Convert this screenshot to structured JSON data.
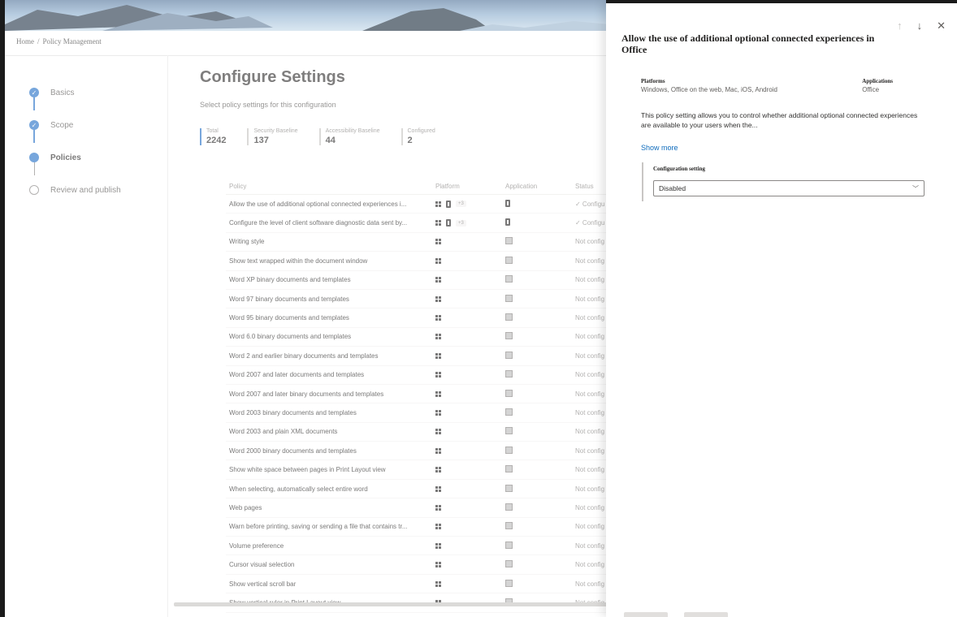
{
  "breadcrumb": {
    "home": "Home",
    "sep": "/",
    "current": "Policy Management"
  },
  "steps": [
    {
      "label": "Basics",
      "state": "done"
    },
    {
      "label": "Scope",
      "state": "done"
    },
    {
      "label": "Policies",
      "state": "active"
    },
    {
      "label": "Review and publish",
      "state": "pending"
    }
  ],
  "page": {
    "title": "Configure Settings",
    "subtitle": "Select policy settings for this configuration"
  },
  "stats": [
    {
      "label": "Total",
      "value": "2242"
    },
    {
      "label": "Security Baseline",
      "value": "137"
    },
    {
      "label": "Accessibility Baseline",
      "value": "44"
    },
    {
      "label": "Configured",
      "value": "2"
    }
  ],
  "table": {
    "headers": {
      "policy": "Policy",
      "platform": "Platform",
      "application": "Application",
      "status": "Status"
    },
    "rows": [
      {
        "policy": "Allow the use of additional optional connected experiences i...",
        "extra": "+3",
        "status": "✓ Configu"
      },
      {
        "policy": "Configure the level of client software diagnostic data sent by...",
        "extra": "+3",
        "status": "✓ Configu"
      },
      {
        "policy": "Writing style",
        "status": "Not config"
      },
      {
        "policy": "Show text wrapped within the document window",
        "status": "Not config"
      },
      {
        "policy": "Word XP binary documents and templates",
        "status": "Not config"
      },
      {
        "policy": "Word 97 binary documents and templates",
        "status": "Not config"
      },
      {
        "policy": "Word 95 binary documents and templates",
        "status": "Not config"
      },
      {
        "policy": "Word 6.0 binary documents and templates",
        "status": "Not config"
      },
      {
        "policy": "Word 2 and earlier binary documents and templates",
        "status": "Not config"
      },
      {
        "policy": "Word 2007 and later documents and templates",
        "status": "Not config"
      },
      {
        "policy": "Word 2007 and later binary documents and templates",
        "status": "Not config"
      },
      {
        "policy": "Word 2003 binary documents and templates",
        "status": "Not config"
      },
      {
        "policy": "Word 2003 and plain XML documents",
        "status": "Not config"
      },
      {
        "policy": "Word 2000 binary documents and templates",
        "status": "Not config"
      },
      {
        "policy": "Show white space between pages in Print Layout view",
        "status": "Not config"
      },
      {
        "policy": "When selecting, automatically select entire word",
        "status": "Not config"
      },
      {
        "policy": "Web pages",
        "status": "Not config"
      },
      {
        "policy": "Warn before printing, saving or sending a file that contains tr...",
        "status": "Not config"
      },
      {
        "policy": "Volume preference",
        "status": "Not config"
      },
      {
        "policy": "Cursor visual selection",
        "status": "Not config"
      },
      {
        "policy": "Show vertical scroll bar",
        "status": "Not config"
      },
      {
        "policy": "Show vertical ruler in Print Layout view",
        "status": "Not config"
      }
    ]
  },
  "panel": {
    "title": "Allow the use of additional optional connected experiences in Office",
    "nav": {
      "up": "↑",
      "down": "↓",
      "close": "✕"
    },
    "platforms_label": "Platforms",
    "platforms_value": "Windows, Office on the web, Mac, iOS, Android",
    "applications_label": "Applications",
    "applications_value": "Office",
    "description": "This policy setting allows you to control whether additional optional connected experiences are available to your users when the...",
    "show_more": "Show more",
    "config_label": "Configuration setting",
    "config_value": "Disabled"
  },
  "colors": {
    "accent": "#2f77c9",
    "link": "#0f6cbd"
  },
  "icons": [
    "check-icon",
    "windows-icon",
    "office-icon",
    "application-icon",
    "arrow-up-icon",
    "arrow-down-icon",
    "close-icon",
    "chevron-down-icon"
  ]
}
